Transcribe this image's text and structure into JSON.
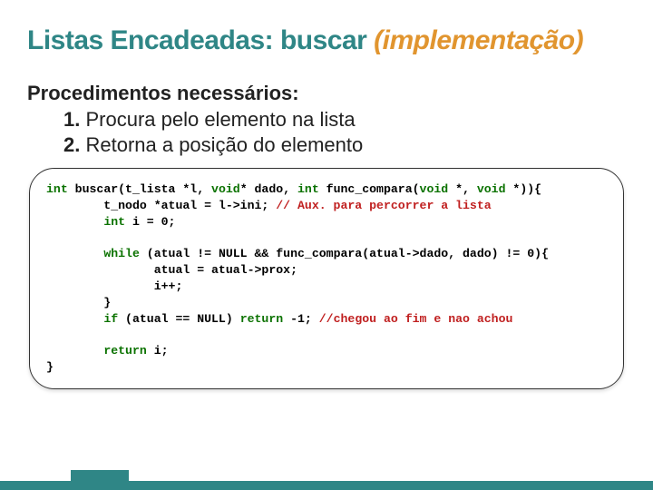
{
  "title": {
    "left": "Listas Encadeadas: buscar ",
    "right": "(implementação)"
  },
  "subheading": "Procedimentos necessários:",
  "steps": [
    {
      "num": "1.",
      "text": " Procura pelo elemento na lista"
    },
    {
      "num": "2.",
      "text": " Retorna a posição do elemento"
    }
  ],
  "code": {
    "l1a": "int",
    "l1b": " buscar(t_lista *l, ",
    "l1c": "void",
    "l1d": "* dado, ",
    "l1e": "int",
    "l1f": " func_compara(",
    "l1g": "void",
    "l1h": " *, ",
    "l1i": "void",
    "l1j": " *)){",
    "l2a": "        t_nodo *atual = l->ini; ",
    "l2b": "// Aux. para percorrer a lista",
    "l3a": "        ",
    "l3b": "int",
    "l3c": " i = 0;",
    "l5a": "        ",
    "l5b": "while",
    "l5c": " (atual != NULL && func_compara(atual->dado, dado) != 0){",
    "l6": "               atual = atual->prox;",
    "l7": "               i++;",
    "l8": "        }",
    "l9a": "        ",
    "l9b": "if",
    "l9c": " (atual == NULL) ",
    "l9d": "return",
    "l9e": " -1; ",
    "l9f": "//chegou ao fim e nao achou",
    "l11a": "        ",
    "l11b": "return",
    "l11c": " i;",
    "l12": "}"
  }
}
